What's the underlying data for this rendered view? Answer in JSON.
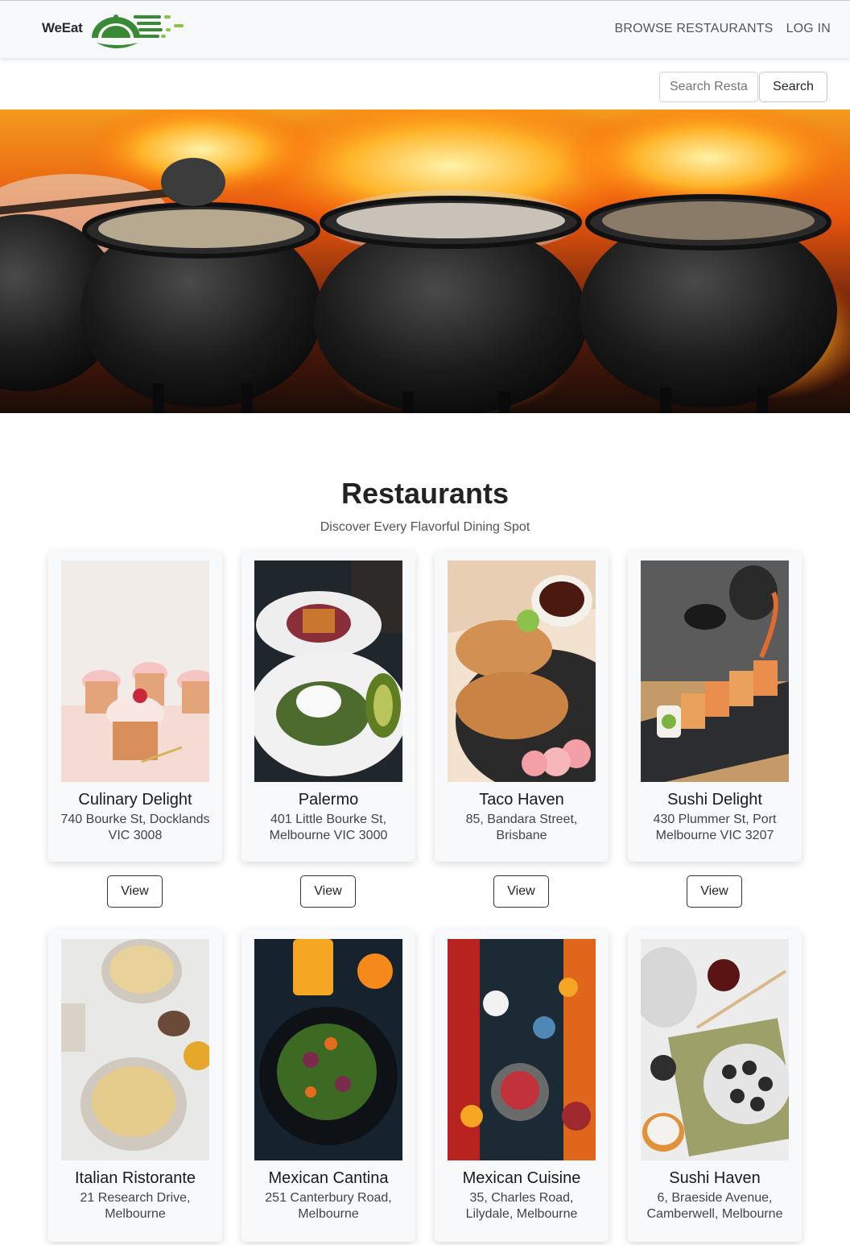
{
  "brand": {
    "name": "WeEat",
    "logo_icon": "cloche-speed-icon",
    "colors": {
      "green": "#3a8a35",
      "lime": "#8bc34a"
    }
  },
  "nav": {
    "browse_label": "BROWSE RESTAURANTS",
    "login_label": "LOG IN"
  },
  "search": {
    "placeholder": "Search Restaurants",
    "button_label": "Search"
  },
  "hero": {
    "image": "cooking-pots-over-fire"
  },
  "section": {
    "title": "Restaurants",
    "subtitle": "Discover Every Flavorful Dining Spot"
  },
  "restaurants": [
    {
      "name": "Culinary Delight",
      "address": "740 Bourke St, Docklands VIC 3008",
      "image": "cupcakes-photo",
      "view_label": "View"
    },
    {
      "name": "Palermo",
      "address": "401 Little Bourke St, Melbourne VIC 3000",
      "image": "brunch-plates-photo",
      "view_label": "View"
    },
    {
      "name": "Taco Haven",
      "address": "85, Bandara Street, Brisbane",
      "image": "tacos-photo",
      "view_label": "View"
    },
    {
      "name": "Sushi Delight",
      "address": "430 Plummer St, Port Melbourne VIC 3207",
      "image": "sushi-roll-photo",
      "view_label": "View"
    },
    {
      "name": "Italian Ristorante",
      "address": "21 Research Drive, Melbourne",
      "image": "pasta-photo"
    },
    {
      "name": "Mexican Cantina",
      "address": "251 Canterbury Road, Melbourne",
      "image": "salad-juice-photo"
    },
    {
      "name": "Mexican Cuisine",
      "address": "35, Charles Road, Lilydale, Melbourne",
      "image": "mexican-spread-photo"
    },
    {
      "name": "Sushi Haven",
      "address": "6, Braeside Avenue, Camberwell, Melbourne",
      "image": "sushi-platter-photo"
    }
  ]
}
